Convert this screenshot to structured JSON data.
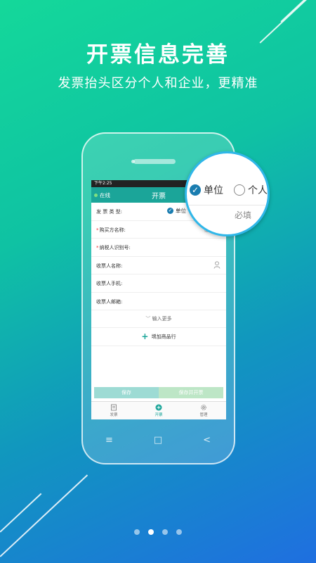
{
  "headline": {
    "title": "开票信息完善",
    "subtitle": "发票抬头区分个人和企业，更精准"
  },
  "phone": {
    "status_time": "下午2:25",
    "online_label": "在线",
    "app_title": "开票",
    "form": {
      "invoice_type_label": "发 票 类 型:",
      "invoice_type_selected": "单位",
      "buyer_name_label": "购买方名称:",
      "buyer_name_hint": "必",
      "tax_id_label": "纳税人识别号:",
      "recipient_name_label": "收票人名称:",
      "recipient_phone_label": "收票人手机:",
      "recipient_email_label": "收票人邮箱:",
      "more_label": "输入更多",
      "add_goods_label": "增加商品行"
    },
    "buttons": {
      "save": "保存",
      "save_and_issue": "保存并开票"
    },
    "tabs": [
      {
        "label": "发票",
        "icon": "invoice-icon"
      },
      {
        "label": "开票",
        "icon": "add-circle-icon"
      },
      {
        "label": "管理",
        "icon": "gear-icon"
      }
    ],
    "nav_keys": [
      "≡",
      "□",
      "<"
    ]
  },
  "magnifier": {
    "option_unit": "单位",
    "option_personal": "个人",
    "required_hint": "必填"
  },
  "pager": {
    "count": 4,
    "active_index": 1
  },
  "colors": {
    "accent": "#1ba599",
    "check_blue": "#1a7db0",
    "magnifier_border": "#2fb7e9"
  }
}
